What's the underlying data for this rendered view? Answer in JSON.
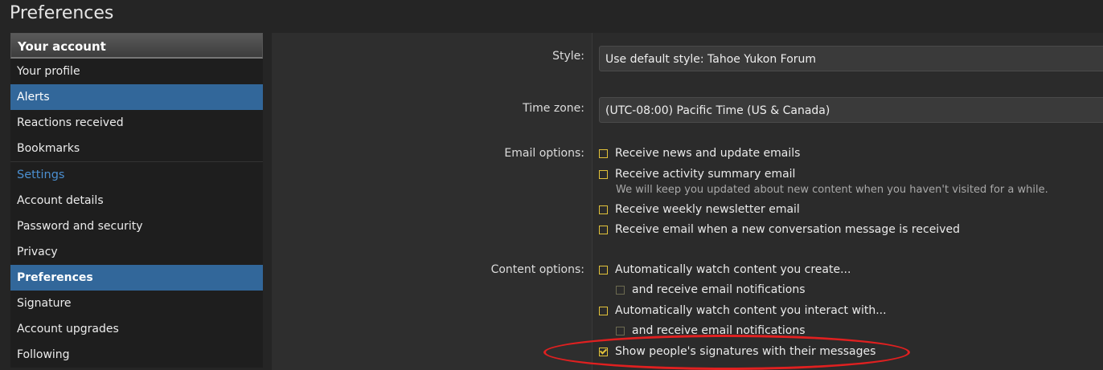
{
  "page": {
    "title": "Preferences"
  },
  "sidebar": {
    "header": "Your account",
    "items_top": [
      "Your profile",
      "Alerts",
      "Reactions received",
      "Bookmarks"
    ],
    "section_label": "Settings",
    "items_settings": [
      "Account details",
      "Password and security",
      "Privacy",
      "Preferences",
      "Signature",
      "Account upgrades",
      "Following"
    ]
  },
  "form": {
    "style": {
      "label": "Style:",
      "value": "Use default style: Tahoe Yukon Forum"
    },
    "timezone": {
      "label": "Time zone:",
      "value": "(UTC-08:00) Pacific Time (US & Canada)"
    },
    "email_options": {
      "label": "Email options:",
      "items": [
        {
          "text": "Receive news and update emails",
          "checked": false
        },
        {
          "text": "Receive activity summary email",
          "checked": false,
          "hint": "We will keep you updated about new content when you haven't visited for a while."
        },
        {
          "text": "Receive weekly newsletter email",
          "checked": false
        },
        {
          "text": "Receive email when a new conversation message is received",
          "checked": false
        }
      ]
    },
    "content_options": {
      "label": "Content options:",
      "watch_create": "Automatically watch content you create...",
      "watch_create_email": "and receive email notifications",
      "watch_interact": "Automatically watch content you interact with...",
      "watch_interact_email": "and receive email notifications",
      "show_signatures": "Show people's signatures with their messages",
      "show_signatures_checked": true
    }
  },
  "colors": {
    "accent_selected": "#32679a",
    "checkbox": "#e2c23a",
    "section_link": "#4b8fd0",
    "annotation": "#e02020"
  },
  "icons": {
    "checkbox": "checkbox-icon",
    "checked": "checkbox-checked-icon"
  }
}
